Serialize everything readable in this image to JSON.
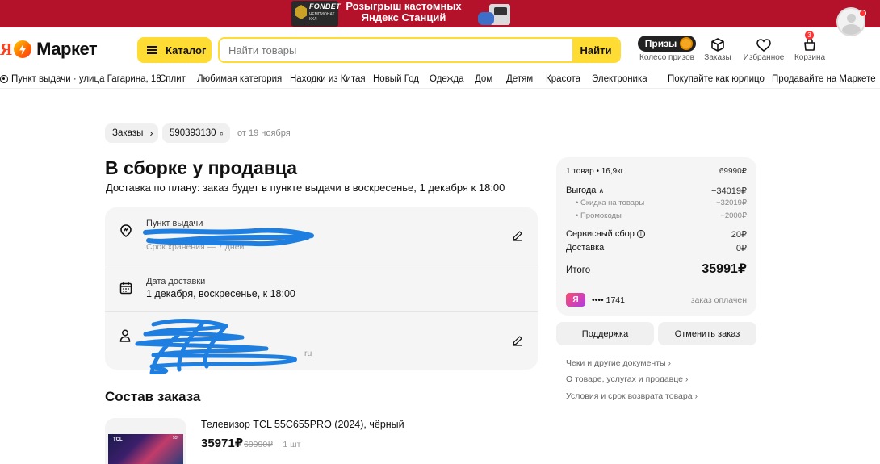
{
  "banner": {
    "brand": "FONBET",
    "brand_sub": "ЧЕМПИОНАТ КХЛ",
    "promo_line1": "Розыгрыш кастомных",
    "promo_line2": "Яндекс Станций",
    "colors": {
      "background": "#b3122a"
    }
  },
  "header": {
    "logo_text": "Маркет",
    "logo_prefix": "Я",
    "catalog_label": "Каталог",
    "search": {
      "placeholder": "Найти товары",
      "value": ""
    },
    "search_button": "Найти",
    "prizes_pill": "Призы",
    "nav": [
      {
        "label": "Колесо призов",
        "icon": "prize-coin-icon"
      },
      {
        "label": "Заказы",
        "icon": "box-icon"
      },
      {
        "label": "Избранное",
        "icon": "heart-icon"
      },
      {
        "label": "Корзина",
        "icon": "cart-icon",
        "badge": "3"
      }
    ]
  },
  "catnav": {
    "pickup": "Пункт выдачи · улица Гагарина, 18",
    "links": [
      "Сплит",
      "Любимая категория",
      "Находки из Китая",
      "Новый Год",
      "Одежда",
      "Дом",
      "Детям",
      "Красота",
      "Электроника"
    ],
    "right_links": [
      "Покупайте как юрлицо",
      "Продавайте на Маркете"
    ]
  },
  "order": {
    "crumb_orders": "Заказы",
    "order_number": "590393130",
    "date": "от 19 ноября",
    "status_title": "В сборке у продавца",
    "delivery_plan": "Доставка по плану: заказ будет в пункте выдачи в воскресенье, 1 декабря к 18:00",
    "pickup_label": "Пункт выдачи",
    "storage_note": "Срок хранения — 7 дней",
    "delivery_date_label": "Дата доставки",
    "delivery_date_value": "1 декабря, воскресенье, к 18:00",
    "recipient_tail": "ru",
    "composition_title": "Состав заказа"
  },
  "product": {
    "name": "Телевизор TCL 55C655PRO (2024), чёрный",
    "price": "35971₽",
    "old_price": "69990₽",
    "qty": "· 1 шт",
    "img_brand": "TCL",
    "img_size": "55\""
  },
  "summary": {
    "items": "1 товар • 16,9кг",
    "items_price": "69990₽",
    "benefit_label": "Выгода",
    "benefit_value": "−34019₽",
    "discount_label": "• Скидка на товары",
    "discount_value": "−32019₽",
    "promo_label": "• Промокоды",
    "promo_value": "−2000₽",
    "service_label": "Сервисный сбор",
    "service_value": "20₽",
    "delivery_label": "Доставка",
    "delivery_value": "0₽",
    "total_label": "Итого",
    "total_value": "35991₽",
    "card_mask": "•••• 1741",
    "card_logo": "Я",
    "pay_status": "заказ оплачен"
  },
  "actions": {
    "support": "Поддержка",
    "cancel": "Отменить заказ"
  },
  "docs": [
    "Чеки и другие документы",
    "О товаре, услугах и продавце",
    "Условия и срок возврата товара"
  ]
}
